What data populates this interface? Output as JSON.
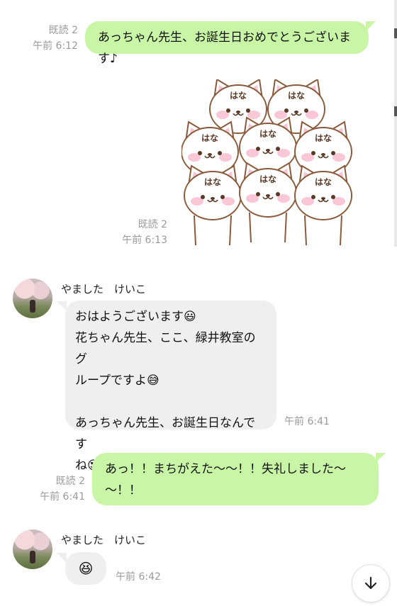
{
  "messages": [
    {
      "type": "out",
      "read": "既読 2",
      "time": "午前 6:12",
      "text": "あっちゃん先生、お誕生日おめでとうございます♪"
    },
    {
      "type": "out-sticker",
      "read": "既読 2",
      "time": "午前 6:13",
      "sticker_label": "はな"
    },
    {
      "type": "in",
      "sender": "やました　けいこ",
      "time": "午前 6:41",
      "lines": [
        "おはようございます😃",
        "花ちゃん先生、ここ、緑井教室のグ",
        "ループですよ😅",
        "",
        "あっちゃん先生、お誕生日なんです",
        "ね😍"
      ]
    },
    {
      "type": "out",
      "read": "既読 2",
      "time": "午前 6:41",
      "lines": [
        "あっ！！まちがえた〜〜！！失礼しました〜",
        "〜！！"
      ]
    },
    {
      "type": "in",
      "sender": "やました　けいこ",
      "time": "午前 6:42",
      "text": "😆"
    }
  ],
  "scroll_button": {
    "icon": "arrow-down-icon"
  },
  "colors": {
    "outgoing": "#c8f5a6",
    "incoming": "#efefef",
    "meta": "#9a9a9a"
  }
}
